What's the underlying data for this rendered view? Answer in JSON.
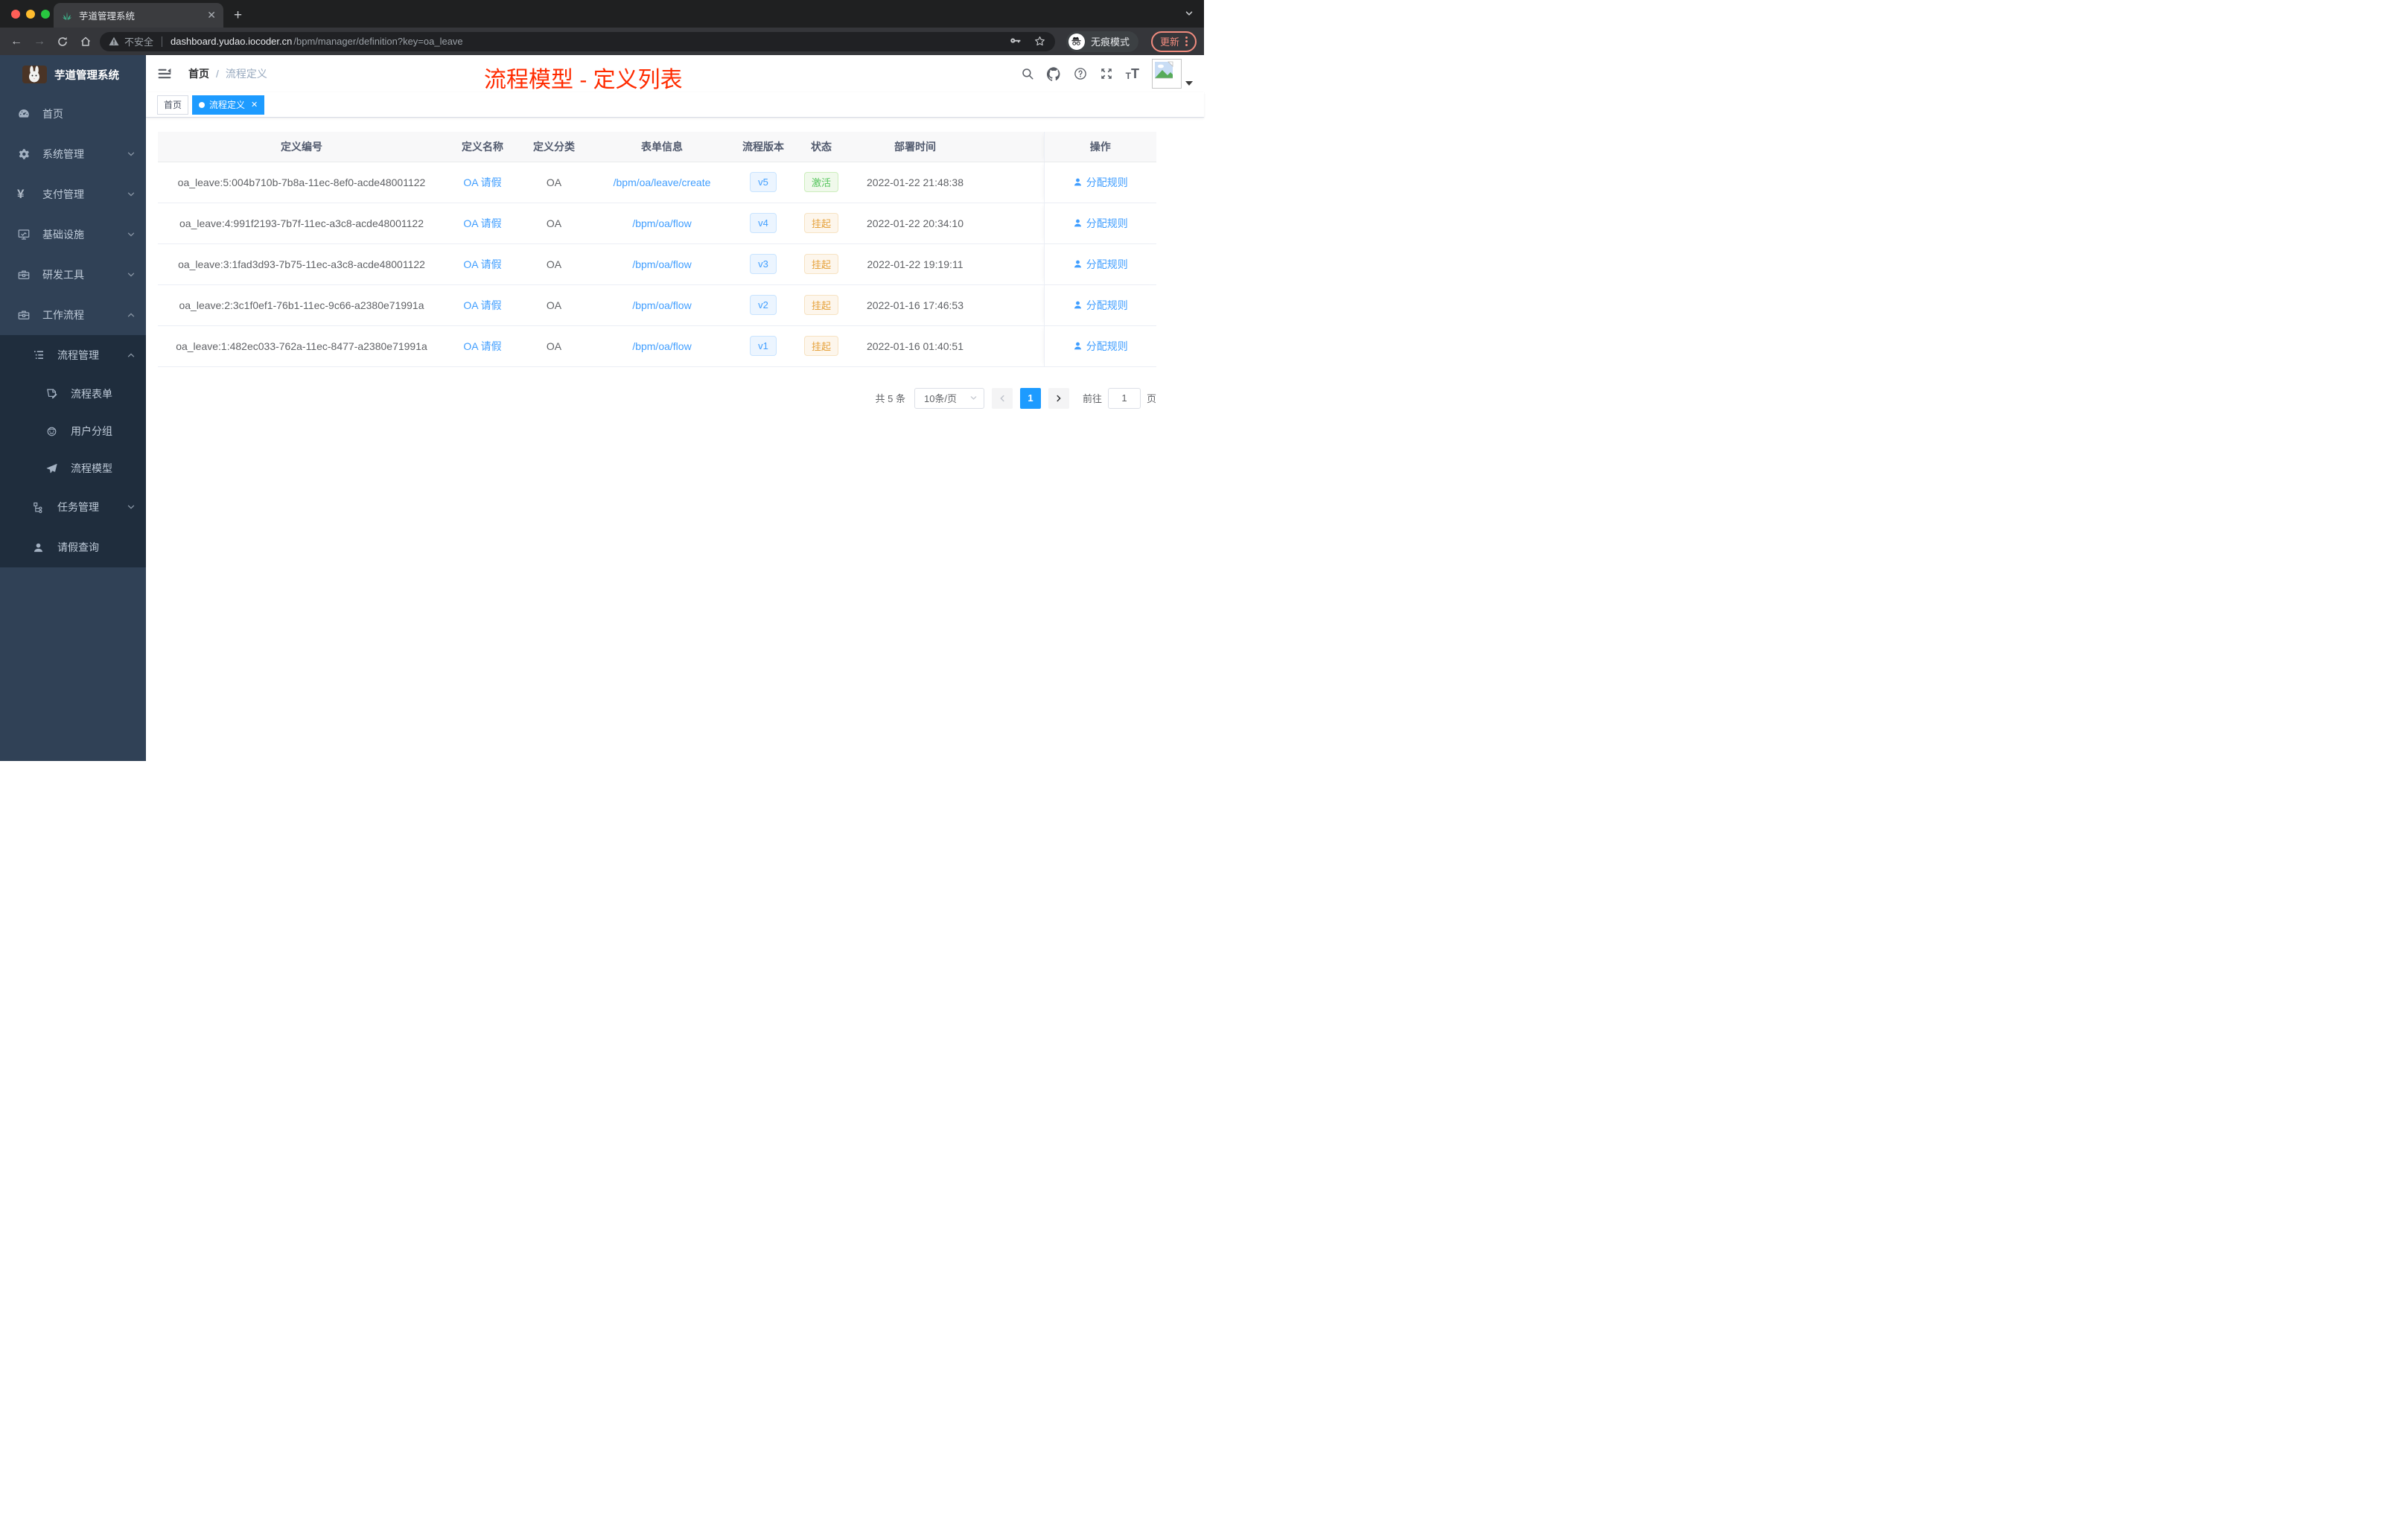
{
  "colors": {
    "accent": "#409eff",
    "tag_active_bg": "#1d9bff",
    "success": "#52c45a",
    "warning": "#e6a23c",
    "annotation_red": "#ff2b00",
    "sidebar_bg": "#304156",
    "submenu_bg": "#1f2d3d"
  },
  "browser": {
    "tab": {
      "title": "芋道管理系统"
    },
    "toolbar": {
      "security_label": "不安全",
      "url_host": "dashboard.yudao.iocoder.cn",
      "url_path": "/bpm/manager/definition?key=oa_leave",
      "incognito_label": "无痕模式",
      "update_label": "更新"
    }
  },
  "sidebar": {
    "logo_title": "芋道管理系统",
    "menu": [
      {
        "label": "首页",
        "icon": "dashboard-icon"
      },
      {
        "label": "系统管理",
        "icon": "gear-icon",
        "arrow": "down"
      },
      {
        "label": "支付管理",
        "icon": "yen-icon",
        "arrow": "down"
      },
      {
        "label": "基础设施",
        "icon": "monitor-icon",
        "arrow": "down"
      },
      {
        "label": "研发工具",
        "icon": "toolbox-icon",
        "arrow": "down"
      },
      {
        "label": "工作流程",
        "icon": "toolbox-icon",
        "arrow": "up"
      }
    ],
    "submenu": [
      {
        "label": "流程管理",
        "icon": "list-tree-icon",
        "arrow": "up"
      },
      {
        "label": "流程表单",
        "icon": "form-doc-icon"
      },
      {
        "label": "用户分组",
        "icon": "robot-icon"
      },
      {
        "label": "流程模型",
        "icon": "paper-plane-icon"
      },
      {
        "label": "任务管理",
        "icon": "org-tree-icon",
        "arrow": "down"
      },
      {
        "label": "请假查询",
        "icon": "user-icon"
      }
    ]
  },
  "navbar": {
    "breadcrumb": {
      "home": "首页",
      "separator": "/",
      "current": "流程定义"
    }
  },
  "tags_view": {
    "tags": [
      {
        "label": "首页",
        "active": false
      },
      {
        "label": "流程定义",
        "active": true
      }
    ]
  },
  "annotation": {
    "text": "流程模型 - 定义列表"
  },
  "table": {
    "columns": {
      "id": "定义编号",
      "name": "定义名称",
      "category": "定义分类",
      "form": "表单信息",
      "version": "流程版本",
      "status": "状态",
      "deployed_at": "部署时间",
      "action": "操作"
    },
    "rows": [
      {
        "id": "oa_leave:5:004b710b-7b8a-11ec-8ef0-acde48001122",
        "name": "OA 请假",
        "category": "OA",
        "form": "/bpm/oa/leave/create",
        "version": "v5",
        "status": "激活",
        "status_type": "success",
        "deployed_at": "2022-01-22 21:48:38",
        "action": "分配规则"
      },
      {
        "id": "oa_leave:4:991f2193-7b7f-11ec-a3c8-acde48001122",
        "name": "OA 请假",
        "category": "OA",
        "form": "/bpm/oa/flow",
        "version": "v4",
        "status": "挂起",
        "status_type": "warning",
        "deployed_at": "2022-01-22 20:34:10",
        "action": "分配规则"
      },
      {
        "id": "oa_leave:3:1fad3d93-7b75-11ec-a3c8-acde48001122",
        "name": "OA 请假",
        "category": "OA",
        "form": "/bpm/oa/flow",
        "version": "v3",
        "status": "挂起",
        "status_type": "warning",
        "deployed_at": "2022-01-22 19:19:11",
        "action": "分配规则"
      },
      {
        "id": "oa_leave:2:3c1f0ef1-76b1-11ec-9c66-a2380e71991a",
        "name": "OA 请假",
        "category": "OA",
        "form": "/bpm/oa/flow",
        "version": "v2",
        "status": "挂起",
        "status_type": "warning",
        "deployed_at": "2022-01-16 17:46:53",
        "action": "分配规则"
      },
      {
        "id": "oa_leave:1:482ec033-762a-11ec-8477-a2380e71991a",
        "name": "OA 请假",
        "category": "OA",
        "form": "/bpm/oa/flow",
        "version": "v1",
        "status": "挂起",
        "status_type": "warning",
        "deployed_at": "2022-01-16 01:40:51",
        "action": "分配规则"
      }
    ]
  },
  "pagination": {
    "total": "共 5 条",
    "page_size": "10条/页",
    "current_page": "1",
    "goto_label": "前往",
    "goto_value": "1",
    "page_unit": "页"
  }
}
